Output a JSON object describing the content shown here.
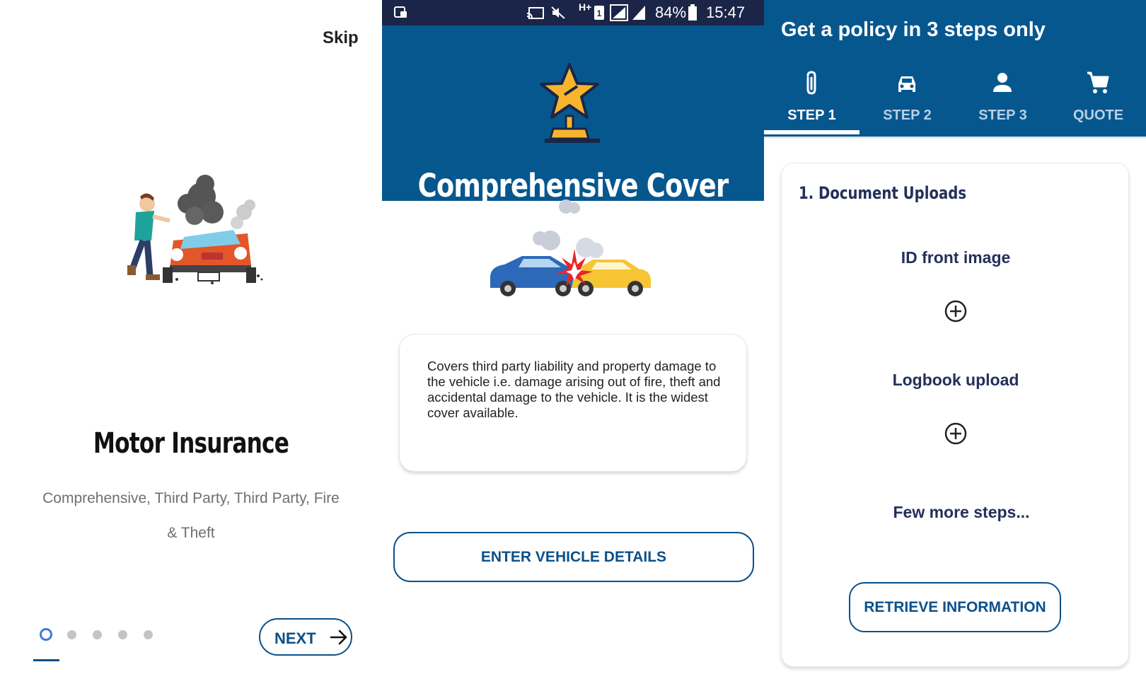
{
  "onboarding": {
    "skip_label": "Skip",
    "title": "Motor Insurance",
    "subtitle": "Comprehensive, Third Party, Third Party, Fire & Theft",
    "next_label": "NEXT",
    "page_indicator": {
      "current": 1,
      "total": 5
    },
    "accent_color": "#0b5089",
    "active_dot_color": "#3e7bd6"
  },
  "cover_detail": {
    "status_bar": {
      "battery": "84%",
      "time": "15:47",
      "network": "H+"
    },
    "title": "Comprehensive Cover",
    "description": "Covers third party liability and property damage to the vehicle i.e. damage arising out of fire, theft and accidental damage to the vehicle. It is the widest cover available.",
    "enter_button_label": "ENTER VEHICLE DETAILS",
    "header_color": "#07578f"
  },
  "policy_steps": {
    "title": "Get a policy in 3 steps only",
    "tabs": [
      {
        "label": "STEP 1",
        "icon": "paperclip-icon",
        "active": true
      },
      {
        "label": "STEP 2",
        "icon": "car-icon",
        "active": false
      },
      {
        "label": "STEP 3",
        "icon": "person-icon",
        "active": false
      },
      {
        "label": "QUOTE",
        "icon": "cart-icon",
        "active": false
      }
    ],
    "section_heading": "1. Document Uploads",
    "id_front_label": "ID front image",
    "logbook_label": "Logbook upload",
    "more_steps_label": "Few more steps...",
    "retrieve_button_label": "RETRIEVE INFORMATION"
  }
}
